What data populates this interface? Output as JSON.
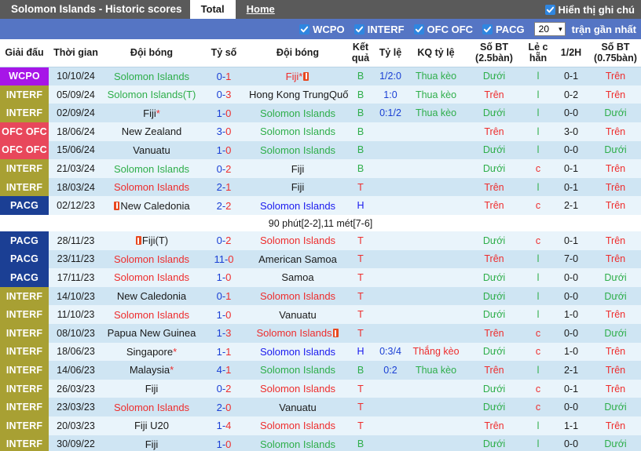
{
  "header": {
    "app_title": "Solomon Islands - Historic scores",
    "tabs": [
      {
        "label": "Total",
        "active": true
      },
      {
        "label": "Home",
        "active": false
      }
    ],
    "show_notes_label": "Hiển thị ghi chú",
    "show_notes_checked": true
  },
  "filters": {
    "leagues": [
      {
        "label": "WCPO",
        "checked": true
      },
      {
        "label": "INTERF",
        "checked": true
      },
      {
        "label": "OFC OFC",
        "checked": true
      },
      {
        "label": "PACG",
        "checked": true
      }
    ],
    "count_value": "20",
    "count_label": "trận gần nhất"
  },
  "columns": [
    "Giải đấu",
    "Thời gian",
    "Đội bóng",
    "Tỷ số",
    "Đội bóng",
    "Kết quả",
    "Tỷ lệ",
    "KQ tỷ lệ",
    "Số BT (2.5bàn)",
    "Lẻ c hẵn",
    "1/2H",
    "Số BT (0.75bàn)"
  ],
  "league_colors": {
    "WCPO": "#a715e8",
    "INTERF": "#a8a033",
    "OFC OFC": "#e8475b",
    "PACG": "#1b3f94"
  },
  "rows": [
    {
      "league": "WCPO",
      "date": "10/10/24",
      "home": "Solomon Islands",
      "home_color": "tA",
      "home_star": false,
      "home_card": false,
      "score_h": "0",
      "score_a": "1",
      "away": "Fiji",
      "away_color": "tR",
      "away_star": true,
      "away_card": true,
      "result": "B",
      "odds": "1/2:0",
      "kq": "Thua kèo",
      "kq_class": "kq-lose",
      "ou": "Dưới",
      "ou_class": "ou-under",
      "oe": "l",
      "oe_class": "oe-l",
      "half": "0-1",
      "ou2": "Trên",
      "ou2_class": "ou-over"
    },
    {
      "league": "INTERF",
      "date": "05/09/24",
      "home": "Solomon Islands(T)",
      "home_color": "tA",
      "home_star": false,
      "home_card": false,
      "score_h": "0",
      "score_a": "3",
      "away": "Hong Kong TrungQuốc",
      "away_color": "tK",
      "away_star": true,
      "away_card": false,
      "away_wrap": true,
      "result": "B",
      "odds": "1:0",
      "kq": "Thua kèo",
      "kq_class": "kq-lose",
      "ou": "Trên",
      "ou_class": "ou-over",
      "oe": "l",
      "oe_class": "oe-l",
      "half": "0-2",
      "ou2": "Trên",
      "ou2_class": "ou-over"
    },
    {
      "league": "INTERF",
      "date": "02/09/24",
      "home": "Fiji",
      "home_color": "tK",
      "home_star": true,
      "home_card": false,
      "score_h": "1",
      "score_a": "0",
      "away": "Solomon Islands",
      "away_color": "tA",
      "away_star": false,
      "away_card": false,
      "result": "B",
      "odds": "0:1/2",
      "kq": "Thua kèo",
      "kq_class": "kq-lose",
      "ou": "Dưới",
      "ou_class": "ou-under",
      "oe": "l",
      "oe_class": "oe-l",
      "half": "0-0",
      "ou2": "Dưới",
      "ou2_class": "ou-under"
    },
    {
      "league": "OFC OFC",
      "date": "18/06/24",
      "home": "New Zealand",
      "home_color": "tK",
      "home_star": false,
      "home_card": false,
      "score_h": "3",
      "score_a": "0",
      "away": "Solomon Islands",
      "away_color": "tA",
      "away_star": false,
      "away_card": false,
      "result": "B",
      "odds": "",
      "kq": "",
      "kq_class": "kq-lose",
      "ou": "Trên",
      "ou_class": "ou-over",
      "oe": "l",
      "oe_class": "oe-l",
      "half": "3-0",
      "ou2": "Trên",
      "ou2_class": "ou-over"
    },
    {
      "league": "OFC OFC",
      "date": "15/06/24",
      "home": "Vanuatu",
      "home_color": "tK",
      "home_star": false,
      "home_card": false,
      "score_h": "1",
      "score_a": "0",
      "away": "Solomon Islands",
      "away_color": "tA",
      "away_star": false,
      "away_card": false,
      "result": "B",
      "odds": "",
      "kq": "",
      "kq_class": "kq-lose",
      "ou": "Dưới",
      "ou_class": "ou-under",
      "oe": "l",
      "oe_class": "oe-l",
      "half": "0-0",
      "ou2": "Dưới",
      "ou2_class": "ou-under"
    },
    {
      "league": "INTERF",
      "date": "21/03/24",
      "home": "Solomon Islands",
      "home_color": "tA",
      "home_star": false,
      "home_card": false,
      "score_h": "0",
      "score_a": "2",
      "away": "Fiji",
      "away_color": "tK",
      "away_star": false,
      "away_card": false,
      "result": "B",
      "odds": "",
      "kq": "",
      "kq_class": "kq-lose",
      "ou": "Dưới",
      "ou_class": "ou-under",
      "oe": "c",
      "oe_class": "oe-c",
      "half": "0-1",
      "ou2": "Trên",
      "ou2_class": "ou-over"
    },
    {
      "league": "INTERF",
      "date": "18/03/24",
      "home": "Solomon Islands",
      "home_color": "tR",
      "home_star": false,
      "home_card": false,
      "score_h": "2",
      "score_a": "1",
      "away": "Fiji",
      "away_color": "tK",
      "away_star": false,
      "away_card": false,
      "result": "T",
      "odds": "",
      "kq": "",
      "kq_class": "kq-lose",
      "ou": "Trên",
      "ou_class": "ou-over",
      "oe": "l",
      "oe_class": "oe-l",
      "half": "0-1",
      "ou2": "Trên",
      "ou2_class": "ou-over"
    },
    {
      "league": "PACG",
      "date": "02/12/23",
      "home": "New Caledonia",
      "home_color": "tK",
      "home_star": false,
      "home_card": true,
      "home_card_left": true,
      "score_h": "2",
      "score_a": "2",
      "away": "Solomon Islands",
      "away_color": "tB",
      "away_star": false,
      "away_card": false,
      "result": "H",
      "odds": "",
      "kq": "",
      "kq_class": "kq-lose",
      "ou": "Trên",
      "ou_class": "ou-over",
      "oe": "c",
      "oe_class": "oe-c",
      "half": "2-1",
      "ou2": "Trên",
      "ou2_class": "ou-over",
      "note": "90 phút[2-2],11 mét[7-6]"
    },
    {
      "league": "PACG",
      "date": "28/11/23",
      "home": "Fiji(T)",
      "home_color": "tK",
      "home_star": false,
      "home_card": true,
      "home_card_left": true,
      "score_h": "0",
      "score_a": "2",
      "away": "Solomon Islands",
      "away_color": "tR",
      "away_star": false,
      "away_card": false,
      "result": "T",
      "odds": "",
      "kq": "",
      "kq_class": "kq-lose",
      "ou": "Dưới",
      "ou_class": "ou-under",
      "oe": "c",
      "oe_class": "oe-c",
      "half": "0-1",
      "ou2": "Trên",
      "ou2_class": "ou-over"
    },
    {
      "league": "PACG",
      "date": "23/11/23",
      "home": "Solomon Islands",
      "home_color": "tR",
      "home_star": false,
      "home_card": false,
      "score_h": "11",
      "score_a": "0",
      "away": "American Samoa",
      "away_color": "tK",
      "away_star": false,
      "away_card": false,
      "result": "T",
      "odds": "",
      "kq": "",
      "kq_class": "kq-lose",
      "ou": "Trên",
      "ou_class": "ou-over",
      "oe": "l",
      "oe_class": "oe-l",
      "half": "7-0",
      "ou2": "Trên",
      "ou2_class": "ou-over"
    },
    {
      "league": "PACG",
      "date": "17/11/23",
      "home": "Solomon Islands",
      "home_color": "tR",
      "home_star": false,
      "home_card": false,
      "score_h": "1",
      "score_a": "0",
      "away": "Samoa",
      "away_color": "tK",
      "away_star": false,
      "away_card": false,
      "result": "T",
      "odds": "",
      "kq": "",
      "kq_class": "kq-lose",
      "ou": "Dưới",
      "ou_class": "ou-under",
      "oe": "l",
      "oe_class": "oe-l",
      "half": "0-0",
      "ou2": "Dưới",
      "ou2_class": "ou-under"
    },
    {
      "league": "INTERF",
      "date": "14/10/23",
      "home": "New Caledonia",
      "home_color": "tK",
      "home_star": false,
      "home_card": false,
      "score_h": "0",
      "score_a": "1",
      "away": "Solomon Islands",
      "away_color": "tR",
      "away_star": false,
      "away_card": false,
      "result": "T",
      "odds": "",
      "kq": "",
      "kq_class": "kq-lose",
      "ou": "Dưới",
      "ou_class": "ou-under",
      "oe": "l",
      "oe_class": "oe-l",
      "half": "0-0",
      "ou2": "Dưới",
      "ou2_class": "ou-under"
    },
    {
      "league": "INTERF",
      "date": "11/10/23",
      "home": "Solomon Islands",
      "home_color": "tR",
      "home_star": false,
      "home_card": false,
      "score_h": "1",
      "score_a": "0",
      "away": "Vanuatu",
      "away_color": "tK",
      "away_star": false,
      "away_card": false,
      "result": "T",
      "odds": "",
      "kq": "",
      "kq_class": "kq-lose",
      "ou": "Dưới",
      "ou_class": "ou-under",
      "oe": "l",
      "oe_class": "oe-l",
      "half": "1-0",
      "ou2": "Trên",
      "ou2_class": "ou-over"
    },
    {
      "league": "INTERF",
      "date": "08/10/23",
      "home": "Papua New Guinea",
      "home_color": "tK",
      "home_star": false,
      "home_card": false,
      "score_h": "1",
      "score_a": "3",
      "away": "Solomon Islands",
      "away_color": "tR",
      "away_star": false,
      "away_card": true,
      "result": "T",
      "odds": "",
      "kq": "",
      "kq_class": "kq-lose",
      "ou": "Trên",
      "ou_class": "ou-over",
      "oe": "c",
      "oe_class": "oe-c",
      "half": "0-0",
      "ou2": "Dưới",
      "ou2_class": "ou-under"
    },
    {
      "league": "INTERF",
      "date": "18/06/23",
      "home": "Singapore",
      "home_color": "tK",
      "home_star": true,
      "home_card": false,
      "score_h": "1",
      "score_a": "1",
      "away": "Solomon Islands",
      "away_color": "tB",
      "away_star": false,
      "away_card": false,
      "result": "H",
      "odds": "0:3/4",
      "kq": "Thắng kèo",
      "kq_class": "kq-win",
      "ou": "Dưới",
      "ou_class": "ou-under",
      "oe": "c",
      "oe_class": "oe-c",
      "half": "1-0",
      "ou2": "Trên",
      "ou2_class": "ou-over"
    },
    {
      "league": "INTERF",
      "date": "14/06/23",
      "home": "Malaysia",
      "home_color": "tK",
      "home_star": true,
      "home_card": false,
      "score_h": "4",
      "score_a": "1",
      "away": "Solomon Islands",
      "away_color": "tA",
      "away_star": false,
      "away_card": false,
      "result": "B",
      "odds": "0:2",
      "kq": "Thua kèo",
      "kq_class": "kq-lose",
      "ou": "Trên",
      "ou_class": "ou-over",
      "oe": "l",
      "oe_class": "oe-l",
      "half": "2-1",
      "ou2": "Trên",
      "ou2_class": "ou-over"
    },
    {
      "league": "INTERF",
      "date": "26/03/23",
      "home": "Fiji",
      "home_color": "tK",
      "home_star": false,
      "home_card": false,
      "score_h": "0",
      "score_a": "2",
      "away": "Solomon Islands",
      "away_color": "tR",
      "away_star": false,
      "away_card": false,
      "result": "T",
      "odds": "",
      "kq": "",
      "kq_class": "kq-lose",
      "ou": "Dưới",
      "ou_class": "ou-under",
      "oe": "c",
      "oe_class": "oe-c",
      "half": "0-1",
      "ou2": "Trên",
      "ou2_class": "ou-over"
    },
    {
      "league": "INTERF",
      "date": "23/03/23",
      "home": "Solomon Islands",
      "home_color": "tR",
      "home_star": false,
      "home_card": false,
      "score_h": "2",
      "score_a": "0",
      "away": "Vanuatu",
      "away_color": "tK",
      "away_star": false,
      "away_card": false,
      "result": "T",
      "odds": "",
      "kq": "",
      "kq_class": "kq-lose",
      "ou": "Dưới",
      "ou_class": "ou-under",
      "oe": "c",
      "oe_class": "oe-c",
      "half": "0-0",
      "ou2": "Dưới",
      "ou2_class": "ou-under"
    },
    {
      "league": "INTERF",
      "date": "20/03/23",
      "home": "Fiji U20",
      "home_color": "tK",
      "home_star": false,
      "home_card": false,
      "score_h": "1",
      "score_a": "4",
      "away": "Solomon Islands",
      "away_color": "tR",
      "away_star": false,
      "away_card": false,
      "result": "T",
      "odds": "",
      "kq": "",
      "kq_class": "kq-lose",
      "ou": "Trên",
      "ou_class": "ou-over",
      "oe": "l",
      "oe_class": "oe-l",
      "half": "1-1",
      "ou2": "Trên",
      "ou2_class": "ou-over"
    },
    {
      "league": "INTERF",
      "date": "30/09/22",
      "home": "Fiji",
      "home_color": "tK",
      "home_star": false,
      "home_card": false,
      "score_h": "1",
      "score_a": "0",
      "away": "Solomon Islands",
      "away_color": "tA",
      "away_star": false,
      "away_card": false,
      "result": "B",
      "odds": "",
      "kq": "",
      "kq_class": "kq-lose",
      "ou": "Dưới",
      "ou_class": "ou-under",
      "oe": "l",
      "oe_class": "oe-l",
      "half": "0-0",
      "ou2": "Dưới",
      "ou2_class": "ou-under"
    }
  ]
}
